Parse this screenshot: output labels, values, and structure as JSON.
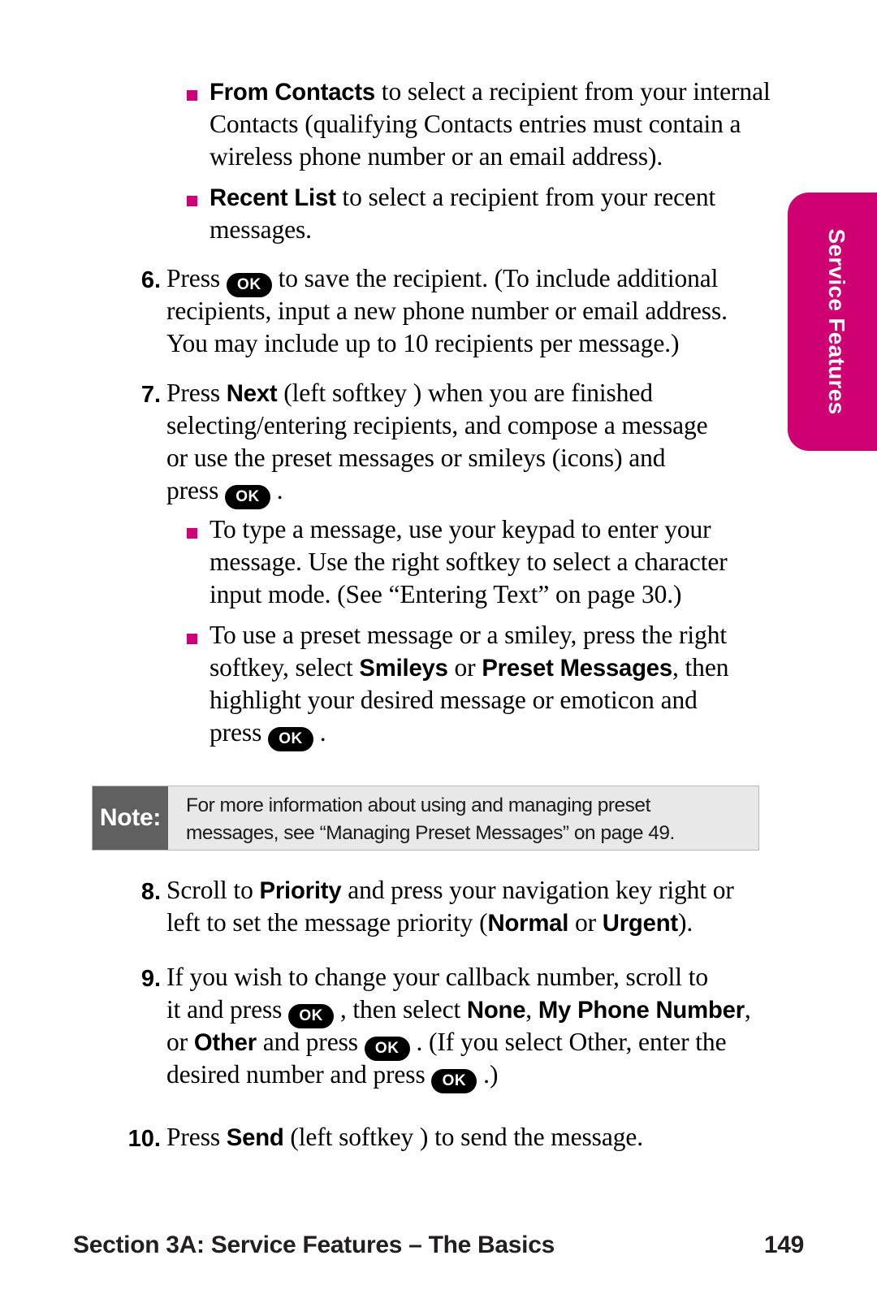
{
  "page": {
    "number": "149",
    "footer_section": "Section 3A: Service Features – The Basics",
    "side_tab_label": "Service Features",
    "accent_color": "#CE0072",
    "bullet_color": "#CE0077"
  },
  "key_glyph": {
    "ok": "OK"
  },
  "top_bullets": [
    {
      "lead": "From Contacts",
      "lines": [
        " to select a recipient from your internal",
        "Contacts (qualifying Contacts entries must contain a",
        "wireless phone number or an email address)."
      ]
    },
    {
      "lead": "Recent List",
      "lines": [
        " to select a recipient from your recent",
        "messages."
      ]
    }
  ],
  "steps": [
    {
      "num": "6.",
      "lines": [
        {
          "parts": [
            {
              "t": "Press ",
              "s": "n"
            },
            {
              "t": "OK",
              "s": "key"
            },
            {
              "t": " to save the recipient. (To include additional",
              "s": "n"
            }
          ]
        },
        {
          "parts": [
            {
              "t": "recipients, input a new phone number or email address.",
              "s": "n"
            }
          ]
        },
        {
          "parts": [
            {
              "t": "You may include up to 10 recipients per message.)",
              "s": "n"
            }
          ]
        }
      ]
    },
    {
      "num": "7.",
      "lines": [
        {
          "parts": [
            {
              "t": "Press ",
              "s": "n"
            },
            {
              "t": "Next",
              "s": "b"
            },
            {
              "t": " (left softkey ) when you are finished",
              "s": "n"
            }
          ]
        },
        {
          "parts": [
            {
              "t": "selecting/entering recipients, and compose a message",
              "s": "n"
            }
          ]
        },
        {
          "parts": [
            {
              "t": "or use the preset messages or smileys (icons) and",
              "s": "n"
            }
          ]
        },
        {
          "parts": [
            {
              "t": "press ",
              "s": "n"
            },
            {
              "t": "OK",
              "s": "key"
            },
            {
              "t": " .",
              "s": "n"
            }
          ]
        }
      ],
      "sub_bullets": [
        {
          "lines": [
            {
              "parts": [
                {
                  "t": "To type a message, use your keypad to enter your",
                  "s": "n"
                }
              ]
            },
            {
              "parts": [
                {
                  "t": "message. Use the right softkey to select a character",
                  "s": "n"
                }
              ]
            },
            {
              "parts": [
                {
                  "t": "input mode. (See “Entering Text” on page 30.)",
                  "s": "n"
                }
              ]
            }
          ]
        },
        {
          "lines": [
            {
              "parts": [
                {
                  "t": "To use a preset  message or a smiley, press the right",
                  "s": "n"
                }
              ]
            },
            {
              "parts": [
                {
                  "t": "softkey, select ",
                  "s": "n"
                },
                {
                  "t": "Smileys",
                  "s": "b"
                },
                {
                  "t": " or ",
                  "s": "n"
                },
                {
                  "t": "Preset Messages",
                  "s": "b"
                },
                {
                  "t": ", then",
                  "s": "n"
                }
              ]
            },
            {
              "parts": [
                {
                  "t": "highlight your desired message or emoticon and",
                  "s": "n"
                }
              ]
            },
            {
              "parts": [
                {
                  "t": "press ",
                  "s": "n"
                },
                {
                  "t": "OK",
                  "s": "key"
                },
                {
                  "t": " .",
                  "s": "n"
                }
              ]
            }
          ]
        }
      ]
    },
    {
      "num": "8.",
      "lines": [
        {
          "parts": [
            {
              "t": "Scroll to ",
              "s": "n"
            },
            {
              "t": "Priority",
              "s": "b"
            },
            {
              "t": " and press your navigation key right or",
              "s": "n"
            }
          ]
        },
        {
          "parts": [
            {
              "t": "left to set the message priority (",
              "s": "n"
            },
            {
              "t": "Normal",
              "s": "b"
            },
            {
              "t": " or ",
              "s": "n"
            },
            {
              "t": "Urgent",
              "s": "b"
            },
            {
              "t": ").",
              "s": "n"
            }
          ]
        }
      ]
    },
    {
      "num": "9.",
      "lines": [
        {
          "parts": [
            {
              "t": "If you wish to change your callback number, scroll to",
              "s": "n"
            }
          ]
        },
        {
          "parts": [
            {
              "t": "it and press ",
              "s": "n"
            },
            {
              "t": "OK",
              "s": "key"
            },
            {
              "t": " , then select ",
              "s": "n"
            },
            {
              "t": "None",
              "s": "b"
            },
            {
              "t": ", ",
              "s": "n"
            },
            {
              "t": "My Phone Number",
              "s": "b"
            },
            {
              "t": ",",
              "s": "n"
            }
          ]
        },
        {
          "parts": [
            {
              "t": "or ",
              "s": "n"
            },
            {
              "t": "Other",
              "s": "b"
            },
            {
              "t": " and press ",
              "s": "n"
            },
            {
              "t": "OK",
              "s": "key"
            },
            {
              "t": " . (If you select Other, enter the",
              "s": "n"
            }
          ]
        },
        {
          "parts": [
            {
              "t": "desired number and press ",
              "s": "n"
            },
            {
              "t": "OK",
              "s": "key"
            },
            {
              "t": " .)",
              "s": "n"
            }
          ]
        }
      ]
    },
    {
      "num": "10.",
      "lines": [
        {
          "parts": [
            {
              "t": "Press ",
              "s": "n"
            },
            {
              "t": "Send",
              "s": "b"
            },
            {
              "t": " (left softkey ) to send the message.",
              "s": "n"
            }
          ]
        }
      ]
    }
  ],
  "note": {
    "label": "Note:",
    "lines": [
      "For more information about using and managing preset",
      "messages, see “Managing Preset Messages” on page 49."
    ]
  }
}
